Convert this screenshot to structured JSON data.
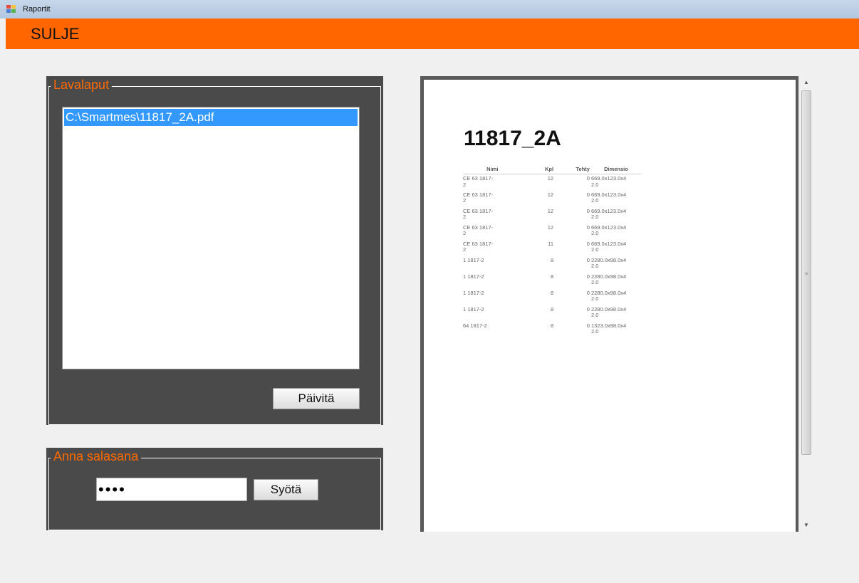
{
  "window": {
    "title": "Raportit"
  },
  "toolbar": {
    "close_label": "SULJE"
  },
  "reports_group": {
    "legend": "Lavalaput",
    "files": [
      "C:\\Smartmes\\11817_2A.pdf"
    ],
    "refresh_label": "Päivitä"
  },
  "password_group": {
    "legend": "Anna salasana",
    "password_value": "••••",
    "submit_label": "Syötä"
  },
  "document": {
    "title": "11817_2A",
    "columns": [
      "Nimi",
      "Kpl",
      "Tehty",
      "Dimensio"
    ],
    "rows": [
      {
        "nimi": "CE 63 1817-\n2",
        "kpl": "12",
        "tehty": "0",
        "dimensio": "669.0x123.0x4\n2.0"
      },
      {
        "nimi": "CE 63 1817-\n2",
        "kpl": "12",
        "tehty": "0",
        "dimensio": "669.0x123.0x4\n2.0"
      },
      {
        "nimi": "CE 63 1817-\n2",
        "kpl": "12",
        "tehty": "0",
        "dimensio": "669.0x123.0x4\n2.0"
      },
      {
        "nimi": "CE 63 1817-\n2",
        "kpl": "12",
        "tehty": "0",
        "dimensio": "669.0x123.0x4\n2.0"
      },
      {
        "nimi": "CE 63 1817-\n2",
        "kpl": "11",
        "tehty": "0",
        "dimensio": "669.0x123.0x4\n2.0"
      },
      {
        "nimi": "1 1817-2",
        "kpl": "8",
        "tehty": "0",
        "dimensio": "2280.0x98.0x4\n2.0"
      },
      {
        "nimi": "1 1817-2",
        "kpl": "8",
        "tehty": "0",
        "dimensio": "2280.0x98.0x4\n2.0"
      },
      {
        "nimi": "1 1817-2",
        "kpl": "8",
        "tehty": "0",
        "dimensio": "2280.0x98.0x4\n2.0"
      },
      {
        "nimi": "1 1817-2",
        "kpl": "8",
        "tehty": "0",
        "dimensio": "2280.0x98.0x4\n2.0"
      },
      {
        "nimi": "64 1817-2",
        "kpl": "8",
        "tehty": "0",
        "dimensio": "1323.0x98.0x4\n2.0"
      }
    ]
  },
  "colors": {
    "accent": "#ff6600",
    "legend_text": "#ff6a00",
    "group_background": "#4a4a4a",
    "selection": "#3399ff"
  },
  "icons": {
    "app": "app-window-icon",
    "scroll_up": "scroll-up-arrow-icon",
    "scroll_down": "scroll-down-arrow-icon"
  }
}
